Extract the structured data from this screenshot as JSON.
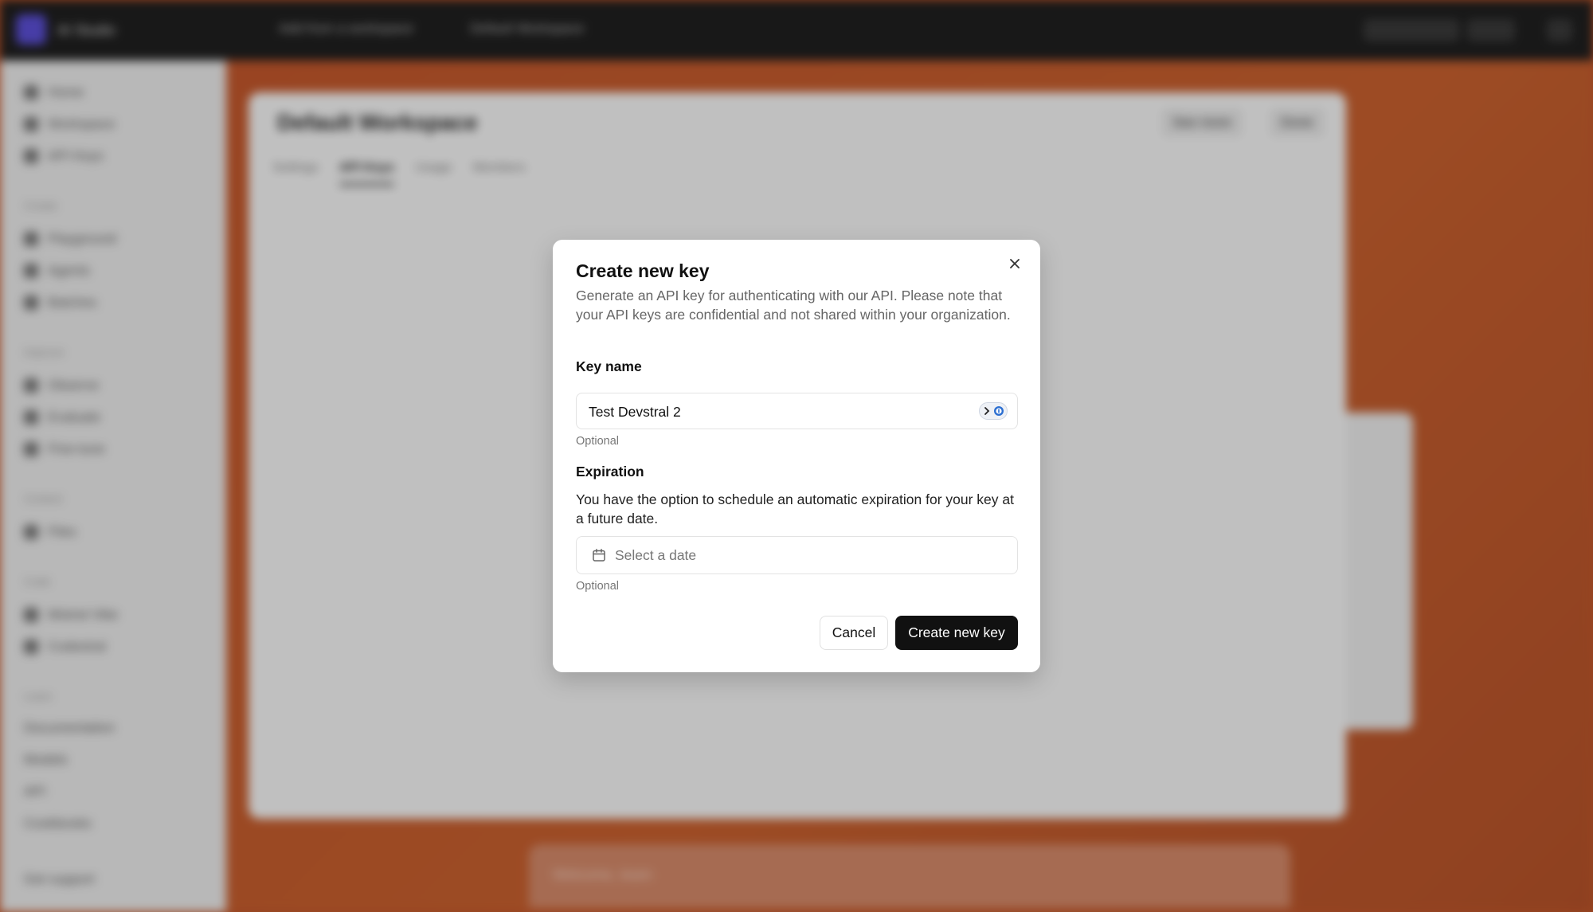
{
  "background": {
    "app_name": "AI Studio",
    "top_links": [
      "Add from a workspace",
      "Default Workspace"
    ],
    "top_right": [
      "Search",
      "⌘K"
    ],
    "sidebar_items": [
      "Home",
      "Workspace",
      "API Keys",
      "Playground",
      "Agents",
      "Batches",
      "Observe",
      "Evaluate",
      "Fine-tune",
      "Files",
      "Mistral Vibe",
      "Codestral",
      "Documentation",
      "Models",
      "API",
      "Cookbooks",
      "Get support"
    ],
    "sidebar_sections": [
      "Create",
      "Improve",
      "Context",
      "Code",
      "Learn"
    ],
    "workspace_title": "Default Workspace",
    "workspace_tabs": [
      "Settings",
      "API Keys",
      "Usage",
      "Members"
    ],
    "workspace_buttons": [
      "See more",
      "Done"
    ],
    "bottom_bar_text": "Welcome, team"
  },
  "modal": {
    "title": "Create new key",
    "description": "Generate an API key for authenticating with our API. Please note that your API keys are confidential and not shared within your organization.",
    "key_name": {
      "label": "Key name",
      "value": "Test Devstral 2",
      "helper": "Optional"
    },
    "expiration": {
      "label": "Expiration",
      "description": "You have the option to schedule an automatic expiration for your key at a future date.",
      "placeholder": "Select a date",
      "helper": "Optional"
    },
    "cancel_label": "Cancel",
    "create_label": "Create new key"
  },
  "colors": {
    "accent_orange": "#c4582c",
    "primary_button": "#111111"
  }
}
